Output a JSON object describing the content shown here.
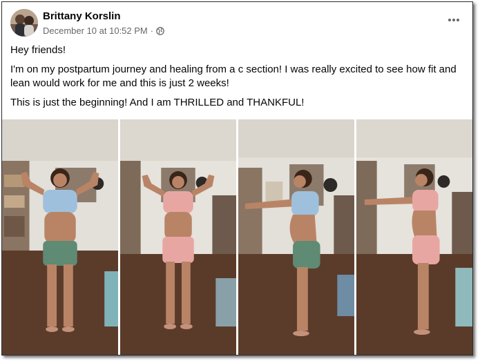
{
  "post": {
    "author": "Brittany Korslin",
    "timestamp": "December 10 at 10:52 PM",
    "separator": "·",
    "privacy_icon": "globe-icon",
    "more_icon": "ellipsis-icon",
    "paragraphs": [
      "Hey friends!",
      "I'm on my postpartum journey and healing from a c section! I was really excited to see how fit and lean would work for me and this is just 2 weeks!",
      "This is just the beginning! And I am THRILLED and THANKFUL!"
    ]
  },
  "photos": [
    {
      "view": "before-front",
      "top_color": "#9fc0dc",
      "bottom_color": "#5f8a73"
    },
    {
      "view": "after-front",
      "top_color": "#e8a6a3",
      "bottom_color": "#e8a6a3"
    },
    {
      "view": "before-side",
      "top_color": "#9fc0dc",
      "bottom_color": "#5f8a73"
    },
    {
      "view": "after-side",
      "top_color": "#e8a6a3",
      "bottom_color": "#e8a6a3"
    }
  ],
  "colors": {
    "text_primary": "#050505",
    "text_secondary": "#65676b",
    "floor": "#5a3c2c",
    "wall": "#e9e5df"
  }
}
